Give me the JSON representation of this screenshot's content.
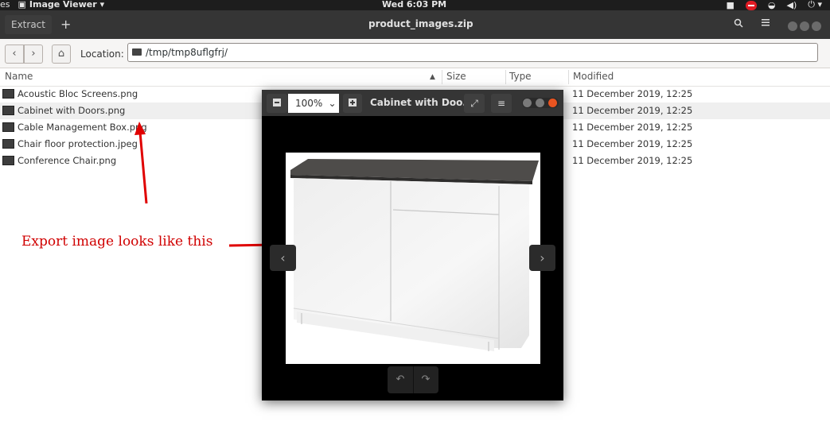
{
  "top_bar": {
    "activities_partial": "es",
    "app_name": "Image Viewer",
    "clock": "Wed  6:03 PM"
  },
  "archive_header": {
    "extract_label": "Extract",
    "add_label": "+",
    "title": "product_images.zip"
  },
  "location": {
    "label": "Location:",
    "path": "/tmp/tmp8uflgfrj/"
  },
  "columns": {
    "name": "Name",
    "size": "Size",
    "type": "Type",
    "modified": "Modified"
  },
  "files": [
    {
      "name": "Acoustic Bloc Screens.png",
      "modified": "11 December 2019, 12:25",
      "selected": false
    },
    {
      "name": "Cabinet with Doors.png",
      "modified": "11 December 2019, 12:25",
      "selected": true
    },
    {
      "name": "Cable Management Box.png",
      "modified": "11 December 2019, 12:25",
      "selected": false
    },
    {
      "name": "Chair floor protection.jpeg",
      "modified": "11 December 2019, 12:25",
      "selected": false
    },
    {
      "name": "Conference Chair.png",
      "modified": "11 December 2019, 12:25",
      "selected": false
    }
  ],
  "viewer": {
    "zoom": "100%",
    "title": "Cabinet with Doo..."
  },
  "annotation": {
    "text": "Export image looks like this",
    "color": "#d00000"
  },
  "colors": {
    "topbar": "#1d1d1d",
    "headerbar": "#353535",
    "accent_close": "#e95420"
  }
}
